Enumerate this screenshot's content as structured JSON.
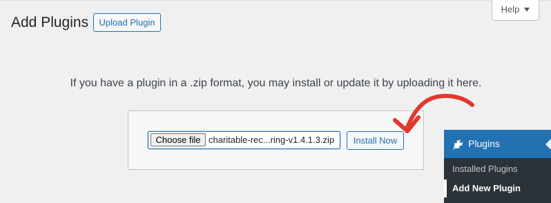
{
  "header": {
    "title": "Add Plugins",
    "upload_button": "Upload Plugin",
    "help_label": "Help"
  },
  "upload": {
    "instructions": "If you have a plugin in a .zip format, you may install or update it by uploading it here.",
    "choose_file_label": "Choose file",
    "file_name": "charitable-rec...ring-v1.4.1.3.zip",
    "install_button": "Install Now"
  },
  "admin_menu": {
    "section_label": "Plugins",
    "section_icon": "plugin-plug-icon",
    "items": [
      {
        "label": "Installed Plugins",
        "active": false
      },
      {
        "label": "Add New Plugin",
        "active": true
      }
    ]
  },
  "annotation": {
    "arrow_color": "#e0392e",
    "arrow_icon": "curved-arrow-icon"
  },
  "colors": {
    "accent": "#2271b1",
    "background": "#f0f0f1",
    "menu_background": "#2c3338"
  }
}
